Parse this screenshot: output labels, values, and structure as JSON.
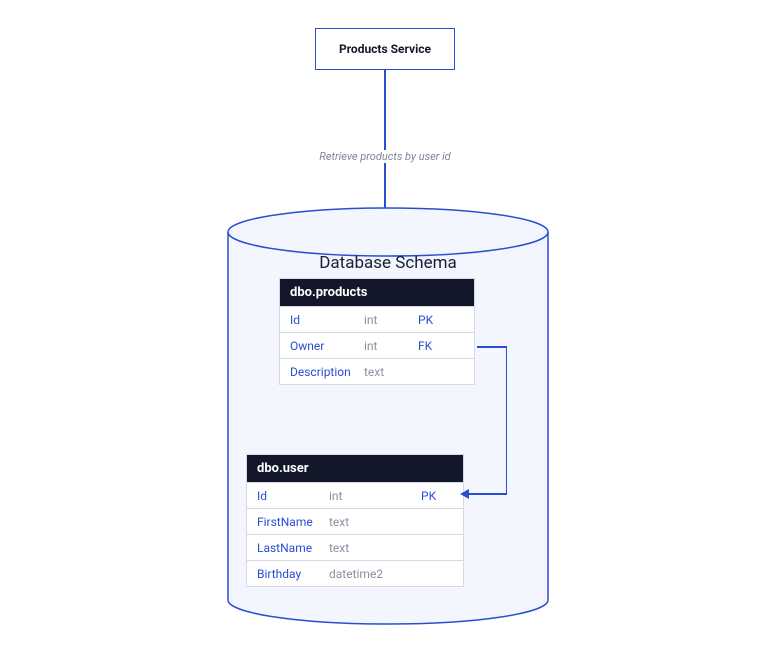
{
  "service": {
    "label": "Products Service"
  },
  "arrow": {
    "label": "Retrieve products by user id"
  },
  "database": {
    "title": "Database Schema",
    "tables": {
      "products": {
        "name": "dbo.products",
        "columns": [
          {
            "name": "Id",
            "type": "int",
            "key": "PK"
          },
          {
            "name": "Owner",
            "type": "int",
            "key": "FK"
          },
          {
            "name": "Description",
            "type": "text",
            "key": ""
          }
        ]
      },
      "user": {
        "name": "dbo.user",
        "columns": [
          {
            "name": "Id",
            "type": "int",
            "key": "PK"
          },
          {
            "name": "FirstName",
            "type": "text",
            "key": ""
          },
          {
            "name": "LastName",
            "type": "text",
            "key": ""
          },
          {
            "name": "Birthday",
            "type": "datetime2",
            "key": ""
          }
        ]
      }
    }
  },
  "colors": {
    "accent": "#2a4ed0",
    "tableHeader": "#12172a",
    "muted": "#8b90a3"
  }
}
